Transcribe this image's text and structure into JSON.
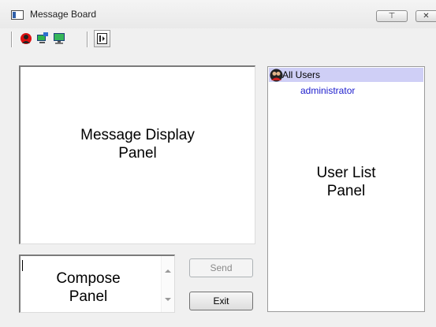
{
  "window": {
    "title": "Message Board",
    "min_glyph": "⊤",
    "close_glyph": "✕"
  },
  "toolbar": {
    "icons": [
      "user-red-icon",
      "network-computer-icon",
      "computer-monitor-icon",
      "panel-toggle-icon"
    ]
  },
  "panels": {
    "message_display": "Message Display\nPanel",
    "compose": "Compose\nPanel",
    "user_list": "User List\nPanel"
  },
  "users": {
    "header": "All Users",
    "items": [
      "administrator"
    ]
  },
  "buttons": {
    "send": "Send",
    "exit": "Exit"
  }
}
